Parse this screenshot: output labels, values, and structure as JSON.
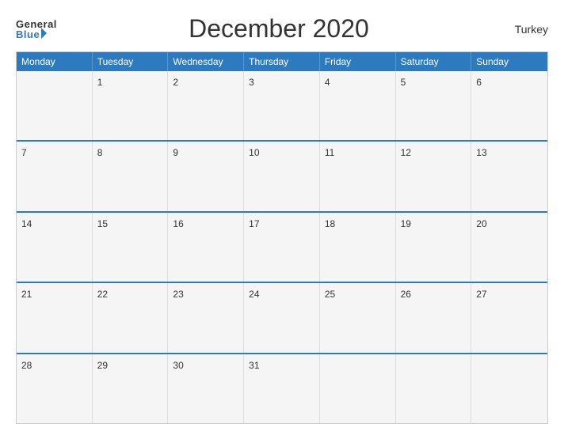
{
  "header": {
    "logo_general": "General",
    "logo_blue": "Blue",
    "title": "December 2020",
    "country": "Turkey"
  },
  "days": {
    "headers": [
      "Monday",
      "Tuesday",
      "Wednesday",
      "Thursday",
      "Friday",
      "Saturday",
      "Sunday"
    ]
  },
  "weeks": [
    [
      {
        "num": "",
        "empty": true
      },
      {
        "num": "1"
      },
      {
        "num": "2"
      },
      {
        "num": "3"
      },
      {
        "num": "4"
      },
      {
        "num": "5"
      },
      {
        "num": "6"
      }
    ],
    [
      {
        "num": "7"
      },
      {
        "num": "8"
      },
      {
        "num": "9"
      },
      {
        "num": "10"
      },
      {
        "num": "11"
      },
      {
        "num": "12"
      },
      {
        "num": "13"
      }
    ],
    [
      {
        "num": "14"
      },
      {
        "num": "15"
      },
      {
        "num": "16"
      },
      {
        "num": "17"
      },
      {
        "num": "18"
      },
      {
        "num": "19"
      },
      {
        "num": "20"
      }
    ],
    [
      {
        "num": "21"
      },
      {
        "num": "22"
      },
      {
        "num": "23"
      },
      {
        "num": "24"
      },
      {
        "num": "25"
      },
      {
        "num": "26"
      },
      {
        "num": "27"
      }
    ],
    [
      {
        "num": "28"
      },
      {
        "num": "29"
      },
      {
        "num": "30"
      },
      {
        "num": "31"
      },
      {
        "num": "",
        "empty": true
      },
      {
        "num": "",
        "empty": true
      },
      {
        "num": "",
        "empty": true
      }
    ]
  ]
}
